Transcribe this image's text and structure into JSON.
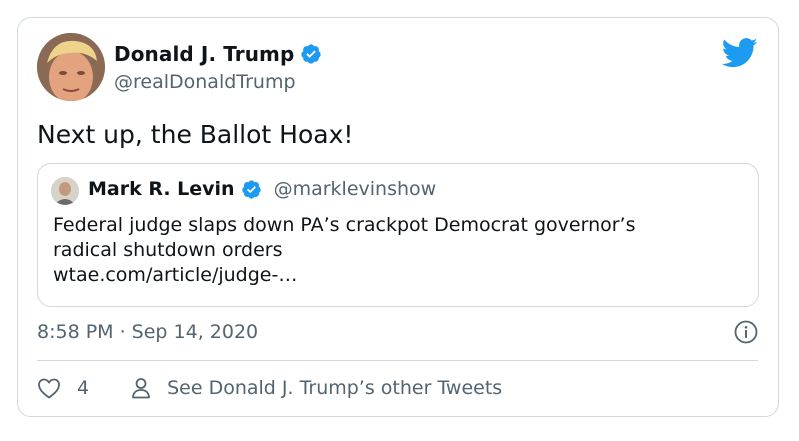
{
  "tweet": {
    "author_name": "Donald J. Trump",
    "author_handle": "@realDonaldTrump",
    "text": "Next up, the Ballot Hoax!",
    "timestamp": "8:58 PM · Sep 14, 2020",
    "like_count": "4",
    "other_tweets_link": "See Donald J. Trump’s other Tweets"
  },
  "quoted_tweet": {
    "author_name": "Mark R. Levin",
    "author_handle": "@marklevinshow",
    "lines": [
      "Federal judge slaps down PA’s crackpot Democrat governor’s",
      "radical shutdown orders",
      "wtae.com/article/judge-…"
    ]
  },
  "colors": {
    "twitter_blue": "#1d9bf0",
    "secondary_text": "#536471",
    "border": "#cfd9de"
  },
  "icons": [
    "verified-badge-icon",
    "twitter-bird-icon",
    "info-icon",
    "heart-icon",
    "person-icon"
  ]
}
